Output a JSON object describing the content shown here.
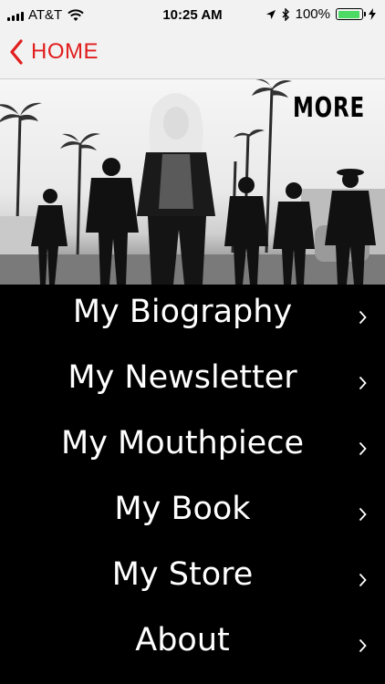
{
  "status_bar": {
    "carrier": "AT&T",
    "time": "10:25 AM",
    "battery": "100%"
  },
  "nav": {
    "back_label": "HOME"
  },
  "hero": {
    "overlay_text": "MORE"
  },
  "menu": {
    "items": [
      {
        "label": "My Biography"
      },
      {
        "label": "My Newsletter"
      },
      {
        "label": "My Mouthpiece"
      },
      {
        "label": "My Book"
      },
      {
        "label": "My Store"
      },
      {
        "label": "About"
      }
    ]
  },
  "colors": {
    "accent": "#e11d1d",
    "menu_bg": "#000000",
    "menu_text": "#ffffff",
    "battery_green": "#4cd964"
  }
}
